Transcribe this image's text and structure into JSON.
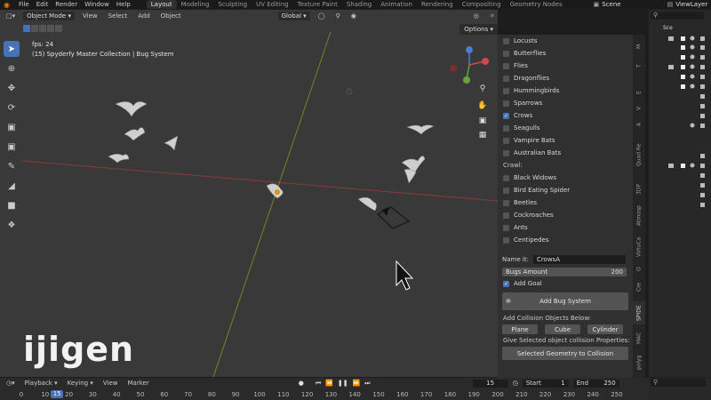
{
  "menubar": {
    "items": [
      "File",
      "Edit",
      "Render",
      "Window",
      "Help"
    ],
    "workspaces": [
      "Layout",
      "Modeling",
      "Sculpting",
      "UV Editing",
      "Texture Paint",
      "Shading",
      "Animation",
      "Rendering",
      "Compositing",
      "Geometry Nodes"
    ],
    "active_workspace": "Layout",
    "scene": "Scene",
    "view_layer": "ViewLayer"
  },
  "viewport": {
    "mode": "Object Mode",
    "menus": [
      "View",
      "Select",
      "Add",
      "Object"
    ],
    "orientation": "Global",
    "options": "Options",
    "fps_text": "fps: 24",
    "collection_text": "(15) Spyderfy Master Collection | Bug System"
  },
  "ntabs": [
    "polyg",
    "MAC",
    "SPIDE",
    "Cre",
    "O",
    "VirtuCa",
    "Atmosp",
    "3DP",
    "Quad Re",
    "A",
    "V",
    "E",
    "T",
    "M"
  ],
  "bug_panel": {
    "fly_items": [
      {
        "label": "Locusts",
        "checked": false
      },
      {
        "label": "Butterflies",
        "checked": false
      },
      {
        "label": "Flies",
        "checked": false
      },
      {
        "label": "Dragonflies",
        "checked": false
      },
      {
        "label": "Hummingbirds",
        "checked": false
      },
      {
        "label": "Sparrows",
        "checked": false
      },
      {
        "label": "Crows",
        "checked": true
      },
      {
        "label": "Seagulls",
        "checked": false
      },
      {
        "label": "Vampire Bats",
        "checked": false
      },
      {
        "label": "Australian Bats",
        "checked": false
      }
    ],
    "crawl_label": "Crawl:",
    "crawl_items": [
      {
        "label": "Black Widows",
        "checked": false
      },
      {
        "label": "Bird Eating Spider",
        "checked": false
      },
      {
        "label": "Beetles",
        "checked": false
      },
      {
        "label": "Cockroaches",
        "checked": false
      },
      {
        "label": "Ants",
        "checked": false
      },
      {
        "label": "Centipedes",
        "checked": false
      }
    ],
    "name_label": "Name it:",
    "name_value": "CrowsA",
    "bugs_amount_label": "Bugs Amount",
    "bugs_amount_value": "200",
    "add_goal_label": "Add Goal",
    "add_bug_system_label": "Add Bug System",
    "collision_heading": "Add Collision Objects Below:",
    "collision_buttons": [
      "Plane",
      "Cube",
      "Cylinder"
    ],
    "give_props_label": "Give Selected object collision Properties:",
    "selected_geo_button": "Selected Geometry to Collision"
  },
  "outliner": {
    "scene_label": "Sce"
  },
  "timeline": {
    "menus": [
      "Playback",
      "Keying",
      "View",
      "Marker"
    ],
    "current_frame": "15",
    "start_label": "Start",
    "start_value": "1",
    "end_label": "End",
    "end_value": "250",
    "ruler_ticks": [
      "0",
      "10",
      "20",
      "30",
      "40",
      "50",
      "60",
      "70",
      "80",
      "90",
      "100",
      "110",
      "120",
      "130",
      "140",
      "150",
      "160",
      "170",
      "180",
      "190",
      "200",
      "210",
      "220",
      "230",
      "240",
      "250"
    ],
    "ruler_cursor": "15"
  },
  "logo_text": "ijigen",
  "colors": {
    "accent": "#4772b3",
    "x_axis": "#8a3a3a",
    "y_axis": "#6a8a2a"
  }
}
